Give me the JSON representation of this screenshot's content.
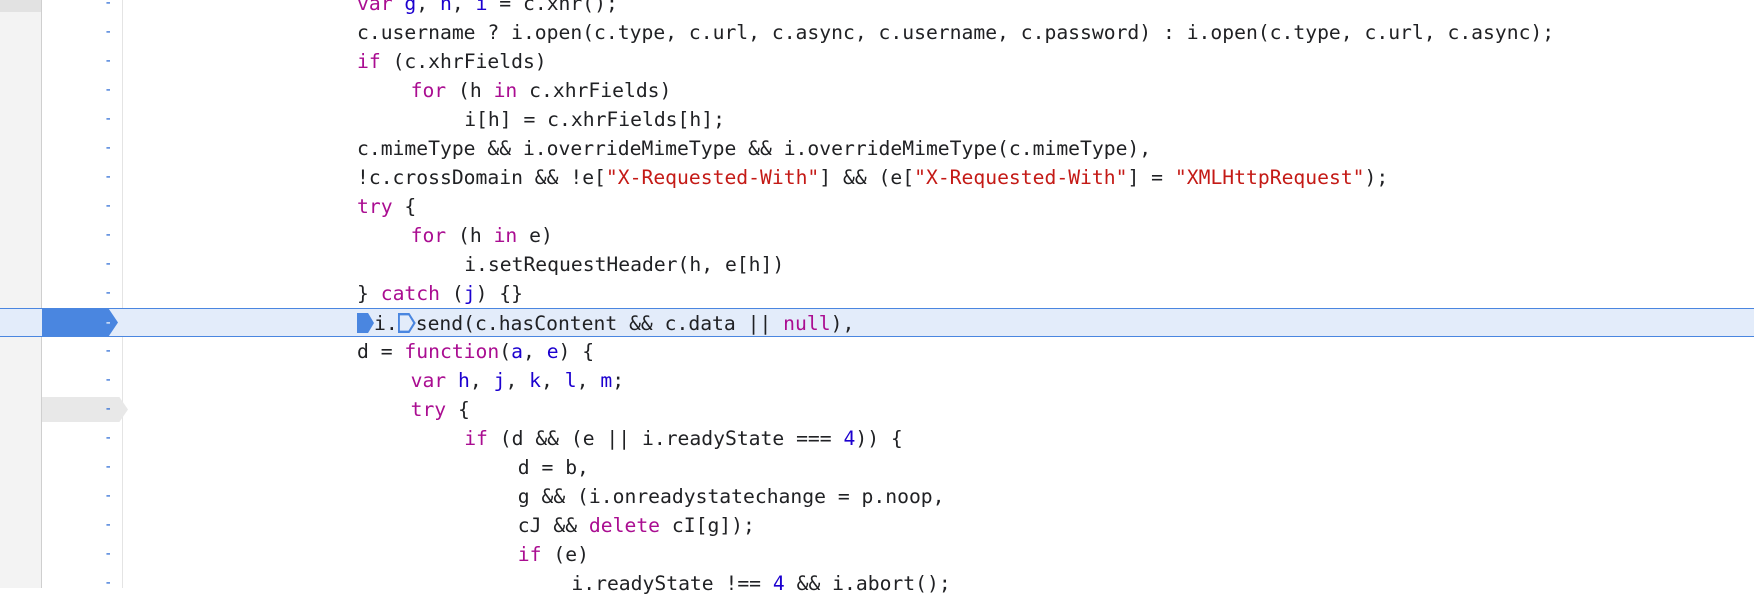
{
  "editor": {
    "gutter_marker": "-",
    "lines": [
      {
        "indent": 0,
        "tokens": [
          [
            "kw",
            "var"
          ],
          [
            "p",
            " "
          ],
          [
            "v",
            "g"
          ],
          [
            "p",
            ", "
          ],
          [
            "v",
            "h"
          ],
          [
            "p",
            ", "
          ],
          [
            "v",
            "i"
          ],
          [
            "p",
            " = c.xhr();"
          ]
        ]
      },
      {
        "indent": 0,
        "tokens": [
          [
            "p",
            "c.username ? i.open(c.type, c.url, c.async, c.username, c.password) : i.open(c.type, c.url, c.async);"
          ]
        ]
      },
      {
        "indent": 0,
        "tokens": [
          [
            "kw",
            "if"
          ],
          [
            "p",
            " (c.xhrFields)"
          ]
        ]
      },
      {
        "indent": 1,
        "tokens": [
          [
            "kw",
            "for"
          ],
          [
            "p",
            " (h "
          ],
          [
            "kw",
            "in"
          ],
          [
            "p",
            " c.xhrFields)"
          ]
        ]
      },
      {
        "indent": 2,
        "tokens": [
          [
            "p",
            "i[h] = c.xhrFields[h];"
          ]
        ]
      },
      {
        "indent": 0,
        "tokens": [
          [
            "p",
            "c.mimeType && i.overrideMimeType && i.overrideMimeType(c.mimeType),"
          ]
        ]
      },
      {
        "indent": 0,
        "tokens": [
          [
            "p",
            "!c.crossDomain && !e["
          ],
          [
            "s",
            "\"X-Requested-With\""
          ],
          [
            "p",
            "] && (e["
          ],
          [
            "s",
            "\"X-Requested-With\""
          ],
          [
            "p",
            "] = "
          ],
          [
            "s",
            "\"XMLHttpRequest\""
          ],
          [
            "p",
            ");"
          ]
        ]
      },
      {
        "indent": 0,
        "tokens": [
          [
            "kw",
            "try"
          ],
          [
            "p",
            " {"
          ]
        ]
      },
      {
        "indent": 1,
        "tokens": [
          [
            "kw",
            "for"
          ],
          [
            "p",
            " (h "
          ],
          [
            "kw",
            "in"
          ],
          [
            "p",
            " e)"
          ]
        ]
      },
      {
        "indent": 2,
        "tokens": [
          [
            "p",
            "i.setRequestHeader(h, e[h])"
          ]
        ]
      },
      {
        "indent": 0,
        "tokens": [
          [
            "p",
            "} "
          ],
          [
            "kw",
            "catch"
          ],
          [
            "p",
            " ("
          ],
          [
            "v",
            "j"
          ],
          [
            "p",
            ") {}"
          ]
        ]
      },
      {
        "indent": 0,
        "paused": true,
        "tokens": [
          [
            "ms",
            ""
          ],
          [
            "p",
            "i."
          ],
          [
            "mo",
            ""
          ],
          [
            "p",
            "send(c.hasContent && c.data || "
          ],
          [
            "kw",
            "null"
          ],
          [
            "p",
            "),"
          ]
        ]
      },
      {
        "indent": 0,
        "tokens": [
          [
            "p",
            "d = "
          ],
          [
            "kw",
            "function"
          ],
          [
            "p",
            "("
          ],
          [
            "v",
            "a"
          ],
          [
            "p",
            ", "
          ],
          [
            "v",
            "e"
          ],
          [
            "p",
            ") {"
          ]
        ]
      },
      {
        "indent": 1,
        "tokens": [
          [
            "kw",
            "var"
          ],
          [
            "p",
            " "
          ],
          [
            "v",
            "h"
          ],
          [
            "p",
            ", "
          ],
          [
            "v",
            "j"
          ],
          [
            "p",
            ", "
          ],
          [
            "v",
            "k"
          ],
          [
            "p",
            ", "
          ],
          [
            "v",
            "l"
          ],
          [
            "p",
            ", "
          ],
          [
            "v",
            "m"
          ],
          [
            "p",
            ";"
          ]
        ]
      },
      {
        "indent": 1,
        "marked": true,
        "tokens": [
          [
            "kw",
            "try"
          ],
          [
            "p",
            " {"
          ]
        ]
      },
      {
        "indent": 2,
        "tokens": [
          [
            "kw",
            "if"
          ],
          [
            "p",
            " (d && (e || i.readyState === "
          ],
          [
            "n",
            "4"
          ],
          [
            "p",
            ")) {"
          ]
        ]
      },
      {
        "indent": 3,
        "tokens": [
          [
            "p",
            "d = b,"
          ]
        ]
      },
      {
        "indent": 3,
        "tokens": [
          [
            "p",
            "g && (i.onreadystatechange = p.noop,"
          ]
        ]
      },
      {
        "indent": 3,
        "tokens": [
          [
            "p",
            "cJ && "
          ],
          [
            "kw",
            "delete"
          ],
          [
            "p",
            " cI[g]);"
          ]
        ]
      },
      {
        "indent": 3,
        "tokens": [
          [
            "kw",
            "if"
          ],
          [
            "p",
            " (e)"
          ]
        ]
      },
      {
        "indent": 4,
        "tokens": [
          [
            "p",
            "i.readyState !== "
          ],
          [
            "n",
            "4"
          ],
          [
            "p",
            " && i.abort();"
          ]
        ]
      }
    ]
  }
}
